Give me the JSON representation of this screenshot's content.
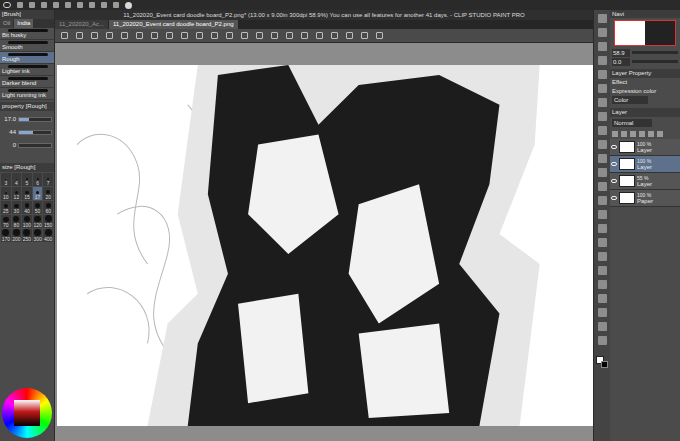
{
  "window": {
    "title": "11_202020_Event card doodle board_P2.png* (13.00 x 9.00in 300dpi 58.9%)  You can use all features for another 41 days. - CLIP STUDIO PAINT PRO"
  },
  "tabs": [
    {
      "label": "11_202020_Ac...",
      "selected": false
    },
    {
      "label": "11_202020_Event card doodle board_P2.png",
      "selected": true
    }
  ],
  "sub_tool": {
    "header": "[Brush]",
    "tabs": [
      {
        "label": "Oil",
        "selected": false
      },
      {
        "label": "India",
        "selected": true
      }
    ],
    "brushes": [
      {
        "name": "Bit husky",
        "selected": false
      },
      {
        "name": "Smooth",
        "selected": false
      },
      {
        "name": "Rough",
        "selected": true
      },
      {
        "name": "Lighter ink",
        "selected": false
      },
      {
        "name": "Darker blend",
        "selected": false
      },
      {
        "name": "Light running ink",
        "selected": false
      }
    ]
  },
  "tool_property": {
    "title": "property [Rough]",
    "sliders": [
      {
        "reading": "17.0",
        "level": 0.3
      },
      {
        "reading": "44",
        "level": 0.44
      },
      {
        "reading": "0",
        "level": 0.0
      }
    ]
  },
  "brush_size": {
    "title": "size [Rough]",
    "sizes": [
      {
        "label": "3",
        "selected": false
      },
      {
        "label": "4",
        "selected": false
      },
      {
        "label": "5",
        "selected": false
      },
      {
        "label": "6",
        "selected": false
      },
      {
        "label": "7",
        "selected": false
      },
      {
        "label": "10",
        "selected": false
      },
      {
        "label": "12",
        "selected": false
      },
      {
        "label": "15",
        "selected": false
      },
      {
        "label": "17",
        "selected": true
      },
      {
        "label": "20",
        "selected": false
      },
      {
        "label": "25",
        "selected": false
      },
      {
        "label": "30",
        "selected": false
      },
      {
        "label": "40",
        "selected": false
      },
      {
        "label": "50",
        "selected": false
      },
      {
        "label": "60",
        "selected": false
      },
      {
        "label": "70",
        "selected": false
      },
      {
        "label": "80",
        "selected": false
      },
      {
        "label": "100",
        "selected": false
      },
      {
        "label": "120",
        "selected": false
      },
      {
        "label": "150",
        "selected": false
      },
      {
        "label": "170",
        "selected": false
      },
      {
        "label": "200",
        "selected": false
      },
      {
        "label": "250",
        "selected": false
      },
      {
        "label": "300",
        "selected": false
      },
      {
        "label": "400",
        "selected": false
      }
    ]
  },
  "navigator": {
    "zoom": "58.9",
    "rotation": "0.0",
    "title": "Navi"
  },
  "layer_property": {
    "title": "Layer Property",
    "effect": "Effect",
    "blend": "Normal",
    "expression_label": "Expression color",
    "expression_value": "Color"
  },
  "layers": {
    "title": "Layer",
    "items": [
      {
        "opacity": "100 %",
        "name": "Layer",
        "visible": true,
        "selected": false
      },
      {
        "opacity": "100 %",
        "name": "Layer",
        "visible": true,
        "selected": true
      },
      {
        "opacity": "55 %",
        "name": "Layer",
        "visible": true,
        "selected": false
      },
      {
        "opacity": "100 %",
        "name": "Paper",
        "visible": true,
        "selected": false
      }
    ]
  }
}
